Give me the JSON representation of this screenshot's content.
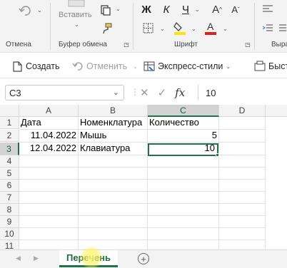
{
  "ribbon": {
    "groups": {
      "undo": "Отмена",
      "clipboard": "Буфер обмена",
      "font": "Шрифт",
      "align": "Выра"
    },
    "paste_label": "Вставить",
    "bold": "Ж",
    "italic": "К",
    "underline": "Ч",
    "grow_font": "A",
    "shrink_font": "A"
  },
  "quick_bar": {
    "create": "Создать",
    "undo": "Отменить",
    "styles": "Экспресс-стили",
    "quick": "Быстрая"
  },
  "formula_bar": {
    "name_box": "C3",
    "fx": "fx",
    "value": "10"
  },
  "columns": [
    "A",
    "B",
    "C",
    "D"
  ],
  "rows": [
    "1",
    "2",
    "3",
    "4",
    "5",
    "6",
    "7",
    "8",
    "9",
    "10",
    "11"
  ],
  "cells": {
    "A1": "Дата",
    "B1": "Номенклатура",
    "C1": "Количество",
    "A2": "11.04.2022",
    "B2": "Мышь",
    "C2": "5",
    "A3": "12.04.2022",
    "B3": "Клавиатура",
    "C3": "10"
  },
  "selection": {
    "active": "C3"
  },
  "sheets": {
    "active": "Перечень"
  },
  "colors": {
    "accent": "#217346",
    "font_color": "#e11d1d",
    "highlight": "#f5e70a"
  }
}
